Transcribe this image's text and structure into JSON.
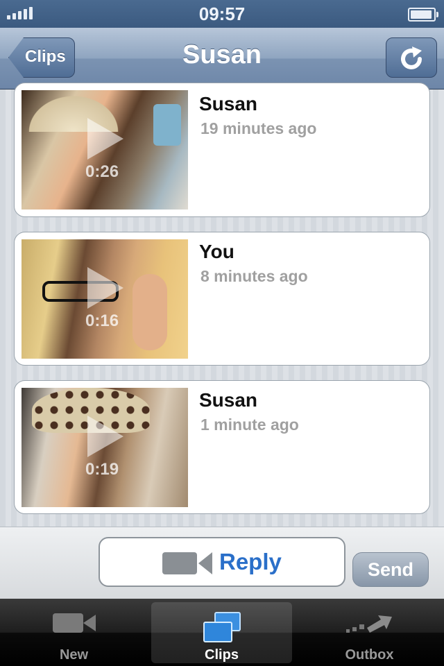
{
  "status": {
    "time": "09:57"
  },
  "nav": {
    "back_label": "Clips",
    "title": "Susan"
  },
  "clips": [
    {
      "sender": "Susan",
      "ago": "19 minutes ago",
      "duration": "0:26"
    },
    {
      "sender": "You",
      "ago": "8 minutes ago",
      "duration": "0:16"
    },
    {
      "sender": "Susan",
      "ago": "1 minute ago",
      "duration": "0:19"
    }
  ],
  "reply": {
    "label": "Reply",
    "send_label": "Send"
  },
  "tabs": [
    {
      "label": "New",
      "icon": "video-camera-icon"
    },
    {
      "label": "Clips",
      "icon": "clips-stack-icon",
      "active": true
    },
    {
      "label": "Outbox",
      "icon": "outbox-arrow-icon"
    }
  ]
}
